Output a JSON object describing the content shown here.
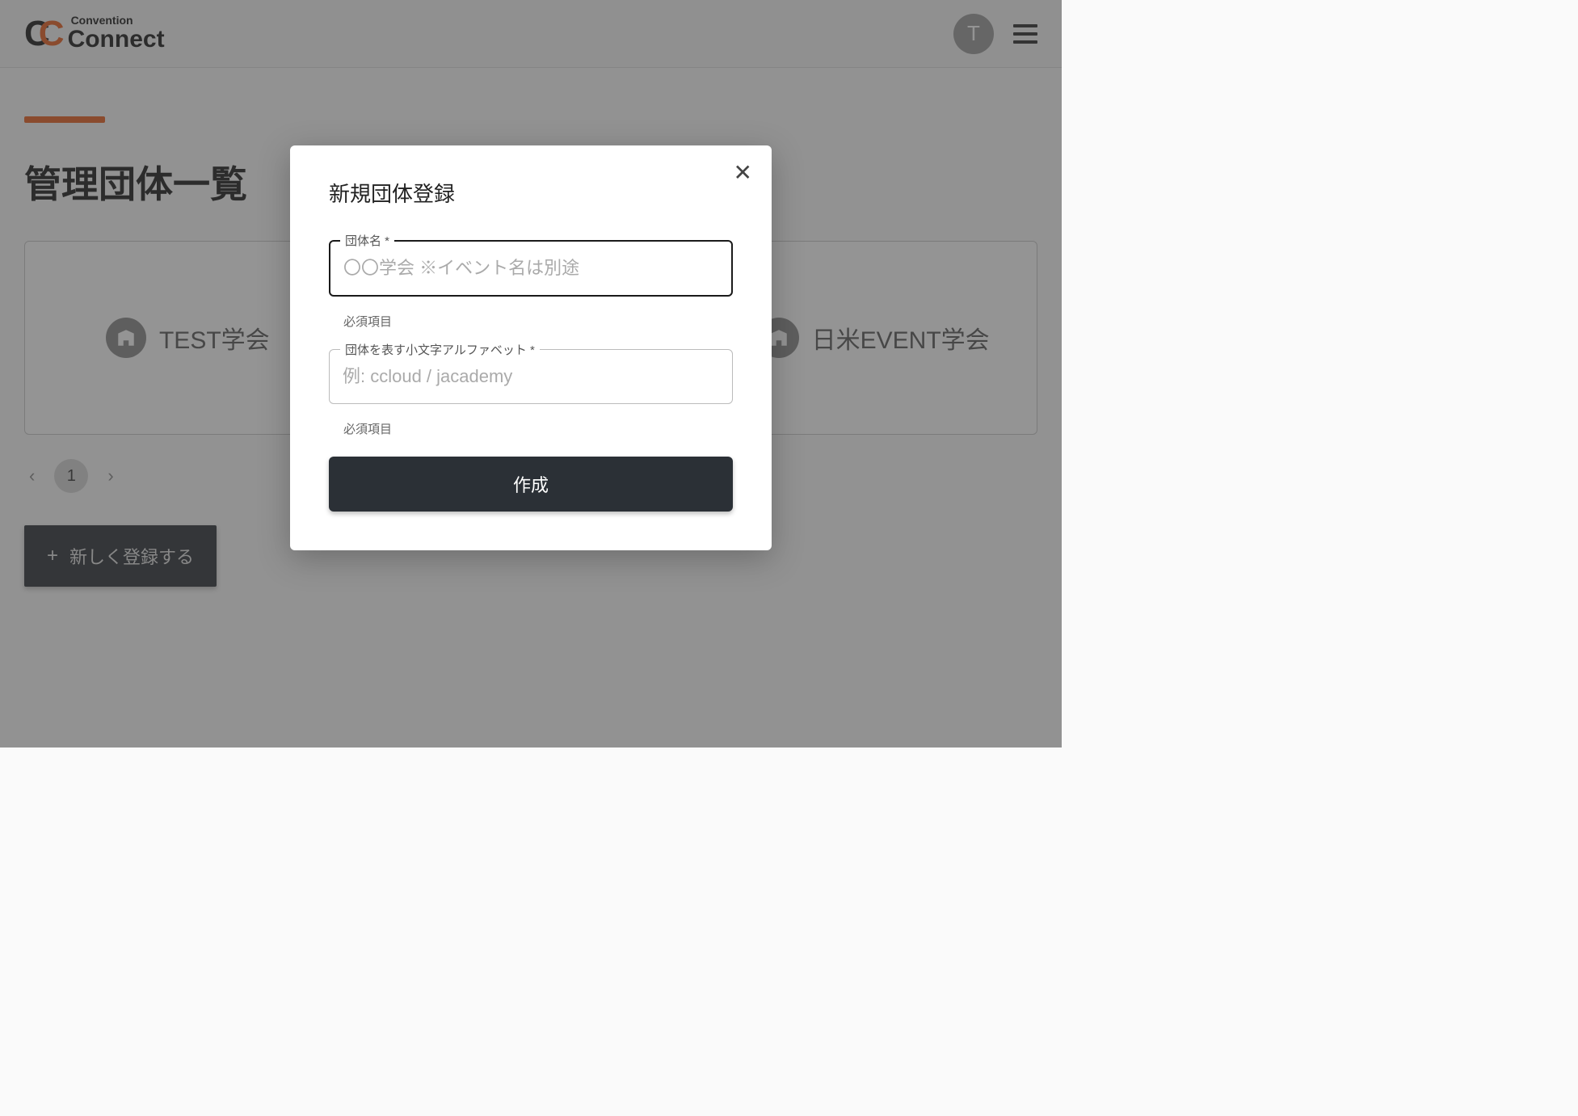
{
  "header": {
    "logo_top": "Convention",
    "logo_bottom": "Connect",
    "avatar_initial": "T"
  },
  "page": {
    "title": "管理団体一覧"
  },
  "cards": [
    {
      "label": "TEST学会"
    },
    {
      "label": ""
    },
    {
      "label": "日米EVENT学会"
    }
  ],
  "pagination": {
    "current": "1"
  },
  "register_button": {
    "label": "新しく登録する"
  },
  "modal": {
    "title": "新規団体登録",
    "field1": {
      "label": "団体名 *",
      "placeholder": "〇〇学会 ※イベント名は別途",
      "helper": "必須項目"
    },
    "field2": {
      "label": "団体を表す小文字アルファベット *",
      "placeholder": "例: ccloud / jacademy",
      "helper": "必須項目"
    },
    "submit": "作成"
  },
  "colors": {
    "accent": "#e85e1e",
    "dark": "#2b3036"
  }
}
